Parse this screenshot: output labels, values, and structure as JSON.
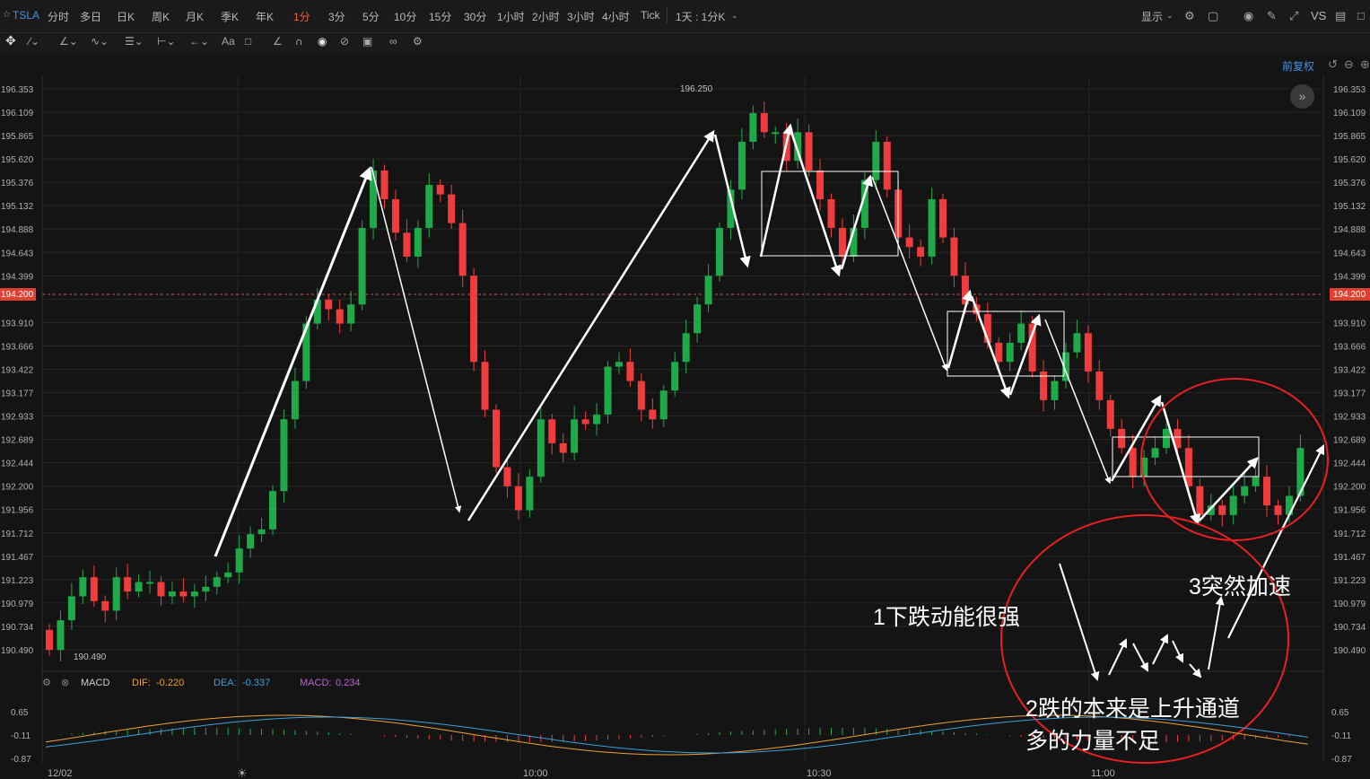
{
  "top_toolbar": {
    "symbol": "TSLA",
    "timeframes": [
      "分时",
      "多日",
      "日K",
      "周K",
      "月K",
      "季K",
      "年K",
      "1分",
      "3分",
      "5分",
      "10分",
      "15分",
      "30分",
      "1小时",
      "2小时",
      "3小时",
      "4小时",
      "Tick"
    ],
    "active_timeframe": "1分",
    "range_selector": "1天 : 1分K",
    "display_label": "显示",
    "vs_label": "VS"
  },
  "drawing_toolbar": {
    "text_tool": "Aa"
  },
  "chart": {
    "adjust_label": "前复权",
    "price_ticks": [
      "196.353",
      "196.109",
      "195.865",
      "195.620",
      "195.376",
      "195.132",
      "194.888",
      "194.643",
      "194.399",
      "193.910",
      "193.666",
      "193.422",
      "193.177",
      "192.933",
      "192.689",
      "192.444",
      "192.200",
      "191.956",
      "191.712",
      "191.467",
      "191.223",
      "190.979",
      "190.734",
      "190.490"
    ],
    "current_price": "194.200",
    "high_label": "196.250",
    "low_label": "190.490",
    "time_labels": [
      "12/02",
      "10:00",
      "10:30",
      "11:00"
    ],
    "colors": {
      "up": "#1faa4a",
      "down": "#f03c3c",
      "background": "#141414",
      "grid": "#262626"
    }
  },
  "macd": {
    "name": "MACD",
    "dif_label": "DIF:",
    "dif_value": "-0.220",
    "dea_label": "DEA:",
    "dea_value": "-0.337",
    "macd_label": "MACD:",
    "macd_value": "0.234",
    "ticks": [
      "0.65",
      "-0.11",
      "-0.87"
    ]
  },
  "annotations": {
    "note1": "1下跌动能很强",
    "note2_line1": "2跌的本来是上升通道",
    "note2_line2": "多的力量不足",
    "note3": "3突然加速"
  }
}
